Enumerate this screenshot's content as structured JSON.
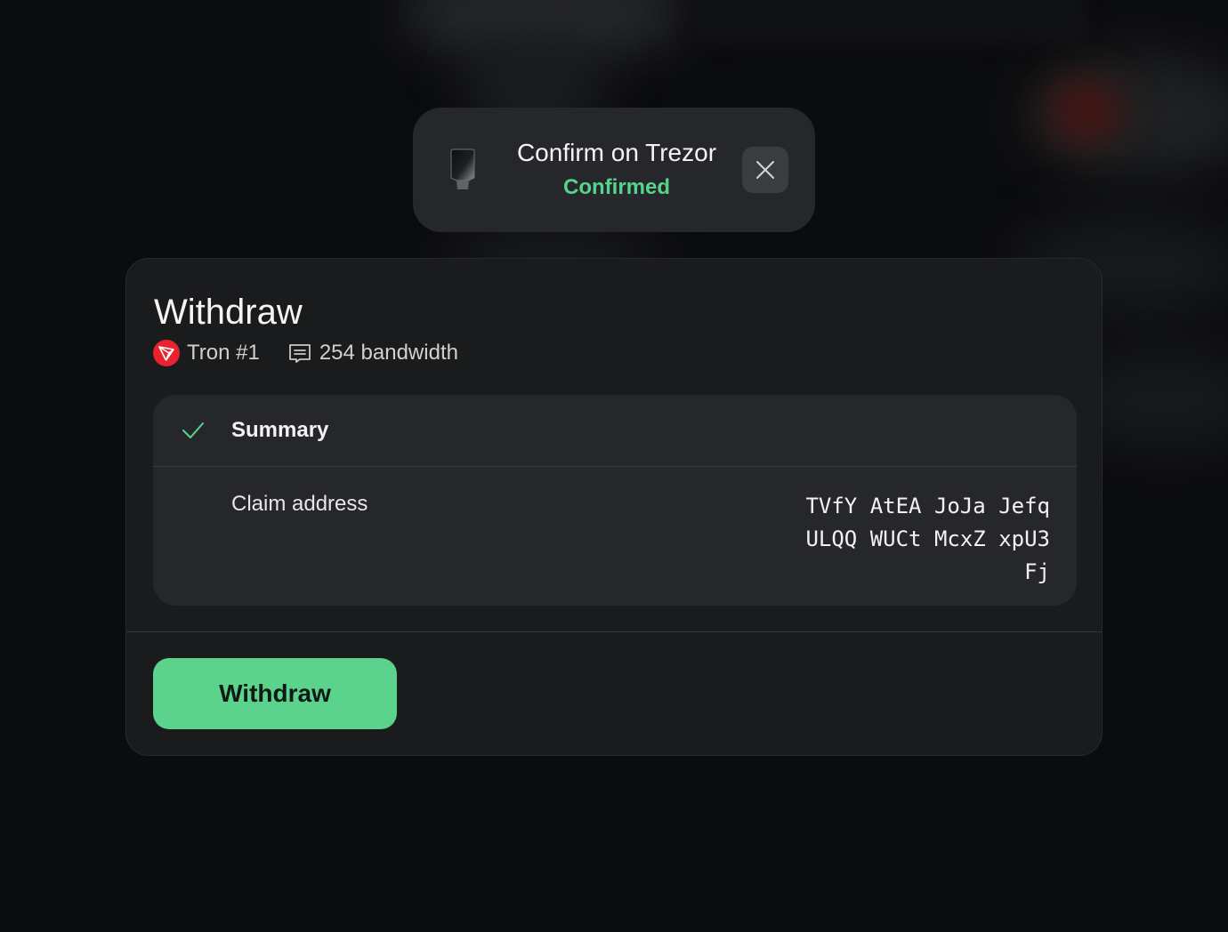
{
  "toast": {
    "title": "Confirm on Trezor",
    "status": "Confirmed",
    "device_icon": "trezor-device-icon",
    "close_icon": "close-icon"
  },
  "card": {
    "title": "Withdraw",
    "account": "Tron #1",
    "bandwidth": "254 bandwidth",
    "account_icon": "tron-icon",
    "bandwidth_icon": "receipt-icon"
  },
  "summary": {
    "label": "Summary",
    "row_label": "Claim address",
    "address_lines": [
      "TVfY AtEA JoJa Jefq",
      "ULQQ WUCt McxZ xpU3",
      "Fj"
    ]
  },
  "actions": {
    "withdraw_label": "Withdraw"
  },
  "colors": {
    "accent": "#5bd38d",
    "background": "#0b0c0e",
    "card": "#1a1b1d",
    "panel": "#25272a",
    "tron_red": "#e8232f"
  }
}
